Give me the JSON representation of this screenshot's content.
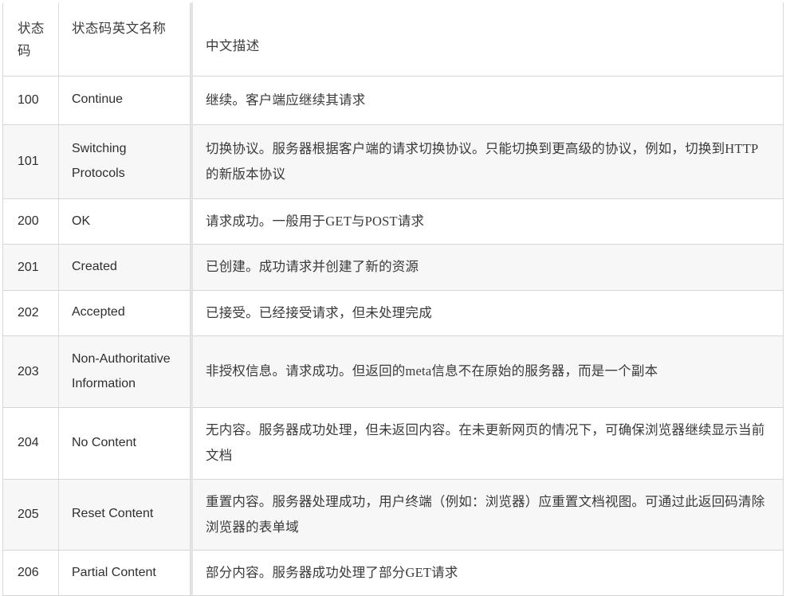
{
  "table": {
    "columns": [
      {
        "key": "code",
        "label": "状态码"
      },
      {
        "key": "name",
        "label": "状态码英文名称"
      },
      {
        "key": "desc",
        "label": "中文描述"
      }
    ],
    "rows": [
      {
        "code": "100",
        "name": "Continue",
        "desc": "继续。客户端应继续其请求"
      },
      {
        "code": "101",
        "name": "Switching Protocols",
        "desc": "切换协议。服务器根据客户端的请求切换协议。只能切换到更高级的协议，例如，切换到HTTP的新版本协议"
      },
      {
        "code": "200",
        "name": "OK",
        "desc": "请求成功。一般用于GET与POST请求"
      },
      {
        "code": "201",
        "name": "Created",
        "desc": "已创建。成功请求并创建了新的资源"
      },
      {
        "code": "202",
        "name": "Accepted",
        "desc": "已接受。已经接受请求，但未处理完成"
      },
      {
        "code": "203",
        "name": "Non-Authoritative Information",
        "desc": "非授权信息。请求成功。但返回的meta信息不在原始的服务器，而是一个副本"
      },
      {
        "code": "204",
        "name": "No Content",
        "desc": "无内容。服务器成功处理，但未返回内容。在未更新网页的情况下，可确保浏览器继续显示当前文档"
      },
      {
        "code": "205",
        "name": "Reset Content",
        "desc": "重置内容。服务器处理成功，用户终端（例如：浏览器）应重置文档视图。可通过此返回码清除浏览器的表单域"
      },
      {
        "code": "206",
        "name": "Partial Content",
        "desc": "部分内容。服务器成功处理了部分GET请求"
      }
    ]
  },
  "colors": {
    "row_stripe": "#f7f7f7",
    "row_plain": "#ffffff",
    "border": "#d6d6d6",
    "text": "#3a3a3a",
    "header_text": "#3b3b3b"
  }
}
